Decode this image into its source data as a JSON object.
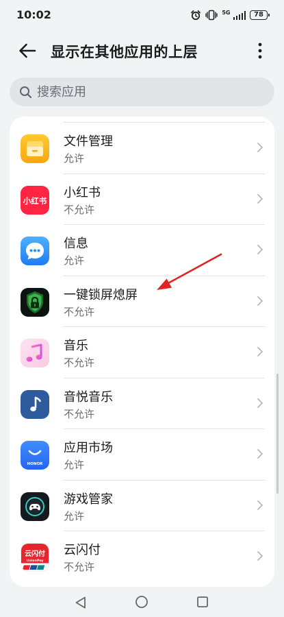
{
  "status_bar": {
    "time": "10:02",
    "network": "5G",
    "battery": "78"
  },
  "header": {
    "title": "显示在其他应用的上层"
  },
  "search": {
    "placeholder": "搜索应用"
  },
  "apps": [
    {
      "name": "文件管理",
      "status": "允许",
      "icon": "file-manager-icon"
    },
    {
      "name": "小红书",
      "status": "不允许",
      "icon": "xiaohongshu-icon",
      "icon_text": "小红书"
    },
    {
      "name": "信息",
      "status": "允许",
      "icon": "messages-icon"
    },
    {
      "name": "一键锁屏熄屏",
      "status": "不允许",
      "icon": "lock-screen-icon"
    },
    {
      "name": "音乐",
      "status": "不允许",
      "icon": "music-icon"
    },
    {
      "name": "音悦音乐",
      "status": "不允许",
      "icon": "yinyue-music-icon"
    },
    {
      "name": "应用市场",
      "status": "允许",
      "icon": "app-market-icon",
      "icon_text": "HONOR"
    },
    {
      "name": "游戏管家",
      "status": "允许",
      "icon": "game-manager-icon"
    },
    {
      "name": "云闪付",
      "status": "不允许",
      "icon": "unionpay-icon",
      "icon_text": "云闪付",
      "icon_subtext": "UnionPay"
    }
  ],
  "colors": {
    "accent_arrow": "#e12323",
    "background": "#f1f3f5",
    "card": "#ffffff"
  }
}
